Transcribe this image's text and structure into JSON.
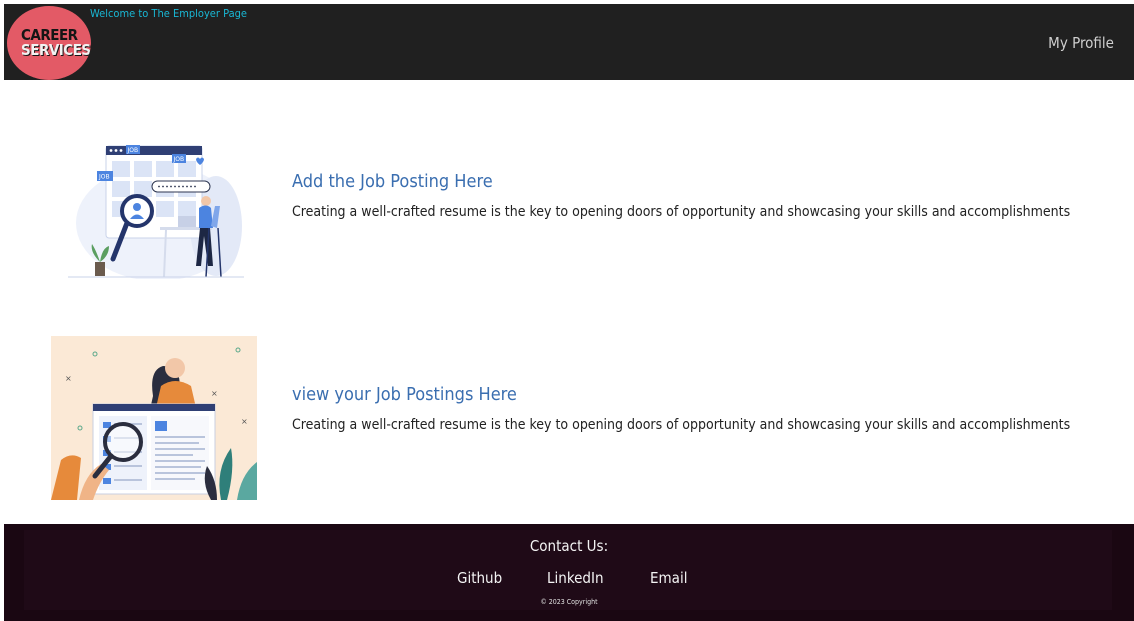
{
  "header": {
    "logo_line1": "CAREER",
    "logo_line2": "SERVICES",
    "welcome": "Welcome to The Employer Page",
    "profile_link": "My Profile"
  },
  "sections": [
    {
      "title": "Add the Job Posting Here",
      "description": "Creating a well-crafted resume is the key to opening doors of opportunity and showcasing your skills and accomplishments",
      "illustration": "job-search-illustration"
    },
    {
      "title": "view your Job Postings Here",
      "description": "Creating a well-crafted resume is the key to opening doors of opportunity and showcasing your skills and accomplishments",
      "illustration": "job-postings-illustration"
    }
  ],
  "footer": {
    "contact_heading": "Contact Us:",
    "links": [
      "Github",
      "LinkedIn",
      "Email"
    ],
    "copyright": "© 2023 Copyright"
  },
  "colors": {
    "header_bg": "#202020",
    "logo_bg": "#e35a66",
    "welcome_text": "#19b7d4",
    "section_title": "#3a6eb0",
    "footer_bg": "#1a0712"
  }
}
